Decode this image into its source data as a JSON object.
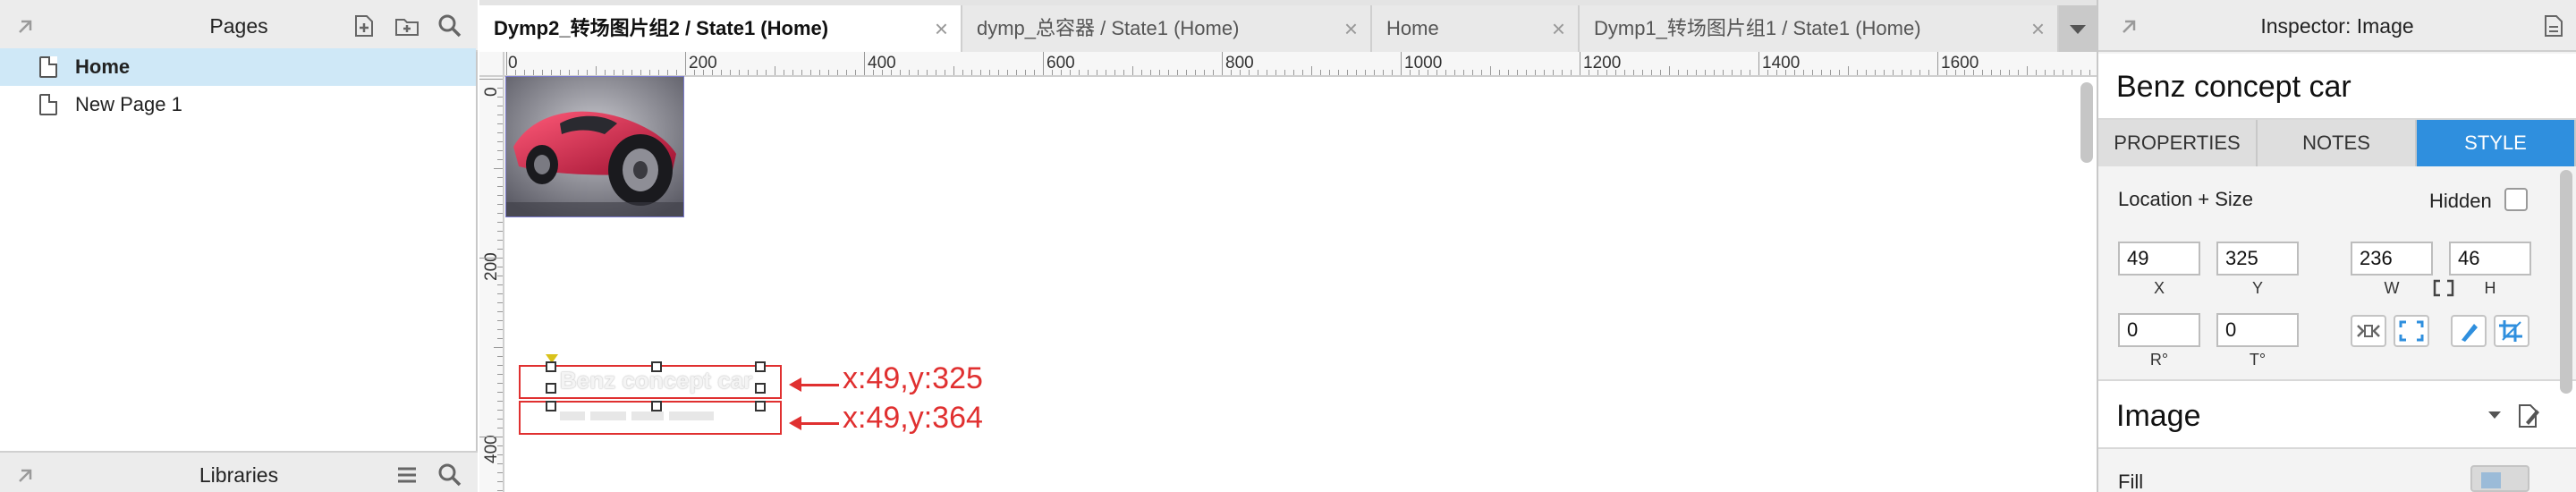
{
  "pages_panel": {
    "title": "Pages",
    "pages": [
      {
        "label": "Home"
      },
      {
        "label": "New Page 1"
      }
    ]
  },
  "libraries_panel": {
    "title": "Libraries"
  },
  "tabs": [
    {
      "label": "Dymp2_转场图片组2 / State1 (Home)",
      "active": true
    },
    {
      "label": "dymp_总容器 / State1 (Home)",
      "active": false
    },
    {
      "label": "Home",
      "active": false
    },
    {
      "label": "Dymp1_转场图片组1 / State1 (Home)",
      "active": false
    }
  ],
  "tab_close_glyph": "×",
  "ruler": {
    "top_labels": [
      "0",
      "200",
      "400",
      "600",
      "800",
      "1000",
      "1200",
      "1400",
      "1600"
    ],
    "left_labels": [
      "0",
      "200",
      "400"
    ]
  },
  "canvas": {
    "widget_text": "Benz concept car",
    "annotations": [
      "x:49,y:325",
      "x:49,y:364"
    ]
  },
  "inspector": {
    "title": "Inspector: Image",
    "widget_name": "Benz concept car",
    "tabs": [
      "PROPERTIES",
      "NOTES",
      "STYLE"
    ],
    "active_tab": "STYLE",
    "location_size_label": "Location + Size",
    "hidden_label": "Hidden",
    "x": "49",
    "y": "325",
    "w": "236",
    "h": "46",
    "x_cap": "X",
    "y_cap": "Y",
    "w_cap": "W",
    "h_cap": "H",
    "rotation": "0",
    "text_rotation": "0",
    "r_cap": "R°",
    "t_cap": "T°",
    "section_title": "Image",
    "fill_label": "Fill"
  },
  "colors": {
    "accent": "#2f8fde",
    "annotation": "#e03030",
    "selected_page": "#cfe8f7"
  }
}
